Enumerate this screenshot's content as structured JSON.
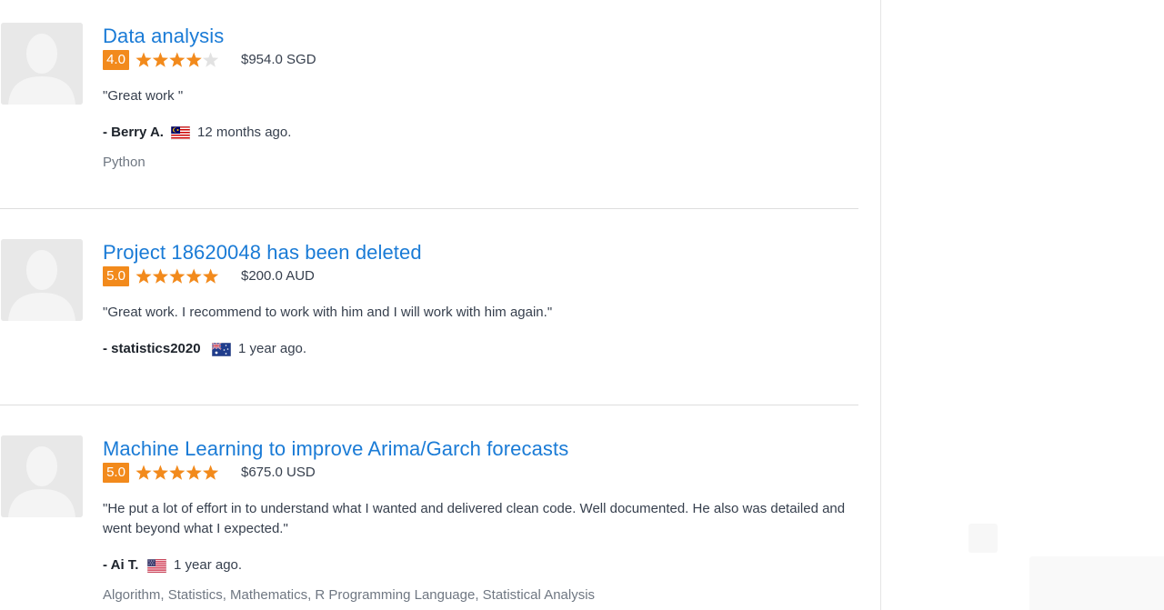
{
  "reviews": [
    {
      "title": "Data analysis",
      "rating": "4.0",
      "stars": 4,
      "amount": "$954.0 SGD",
      "quote": "\"Great work \"",
      "reviewer": "- Berry A.",
      "flag": "MY",
      "time_ago": "12 months ago.",
      "skills": "Python"
    },
    {
      "title": "Project 18620048 has been deleted",
      "rating": "5.0",
      "stars": 5,
      "amount": "$200.0 AUD",
      "quote": "\"Great work. I recommend to work with him and I will work with him again.\"",
      "reviewer": "- statistics2020",
      "flag": "AU",
      "time_ago": "1 year ago.",
      "skills": ""
    },
    {
      "title": "Machine Learning to improve Arima/Garch forecasts",
      "rating": "5.0",
      "stars": 5,
      "amount": "$675.0 USD",
      "quote": "\"He put a lot of effort in to understand what I wanted and delivered clean code. Well documented. He also was detailed and went beyond what I expected.\"",
      "reviewer": "- Ai T.",
      "flag": "US",
      "time_ago": "1 year ago.",
      "skills": "Algorithm, Statistics, Mathematics, R Programming Language, Statistical Analysis"
    }
  ],
  "colors": {
    "link": "#1a7bd6",
    "rating_badge": "#f28a1c",
    "star_filled": "#f28a1c",
    "star_empty": "#e2e2e2"
  }
}
